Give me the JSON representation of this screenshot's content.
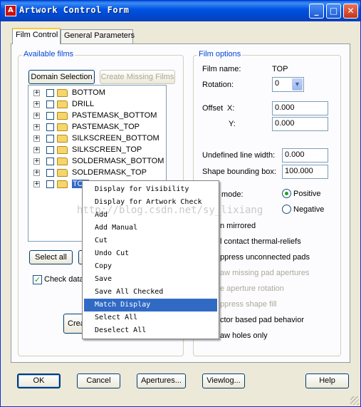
{
  "window": {
    "title": "Artwork Control Form",
    "app_icon": "allegro-app-icon",
    "controls": {
      "minimize": "_",
      "maximize": "□",
      "close": "✕"
    }
  },
  "tabs": [
    {
      "label": "Film Control",
      "active": true
    },
    {
      "label": "General Parameters",
      "active": false
    }
  ],
  "available_films": {
    "legend": "Available films",
    "domain_selection": "Domain Selection",
    "create_missing_films": "Create Missing Films",
    "films": [
      {
        "label": "BOTTOM"
      },
      {
        "label": "DRILL"
      },
      {
        "label": "PASTEMASK_BOTTOM"
      },
      {
        "label": "PASTEMASK_TOP"
      },
      {
        "label": "SILKSCREEN_BOTTOM"
      },
      {
        "label": "SILKSCREEN_TOP"
      },
      {
        "label": "SOLDERMASK_BOTTOM"
      },
      {
        "label": "SOLDERMASK_TOP"
      },
      {
        "label": "TOP",
        "selected": true
      }
    ],
    "select_all": "Select all",
    "check_database": "Check data",
    "check_database_checked": true,
    "create_button_partial": "Crea"
  },
  "film_options": {
    "legend": "Film options",
    "film_name_label": "Film name:",
    "film_name_value": "TOP",
    "rotation_label": "Rotation:",
    "rotation_value": "0",
    "offset_label": "Offset",
    "offset_x_label": "X:",
    "offset_x_value": "0.000",
    "offset_y_label": "Y:",
    "offset_y_value": "0.000",
    "undefined_line_width_label": "Undefined line width:",
    "undefined_line_width_value": "0.000",
    "shape_bounding_box_label": "Shape bounding box:",
    "shape_bounding_box_value": "100.000",
    "plot_mode_label": "mode:",
    "positive_label": "Positive",
    "negative_label": "Negative",
    "plot_mode_value": "Positive",
    "options": [
      {
        "label": "n mirrored",
        "disabled": false
      },
      {
        "label": "l contact thermal-reliefs",
        "disabled": false
      },
      {
        "label": "ppress unconnected pads",
        "disabled": false
      },
      {
        "label": "aw missing pad apertures",
        "disabled": true
      },
      {
        "label": "e aperture rotation",
        "disabled": true
      },
      {
        "label": "ppress shape fill",
        "disabled": true
      },
      {
        "label": "ctor based pad behavior",
        "disabled": false
      },
      {
        "label": "aw holes only",
        "disabled": false
      }
    ]
  },
  "context_menu": {
    "items": [
      {
        "label": "Display for Visibility"
      },
      {
        "label": "Display for Artwork Check"
      },
      {
        "label": "Add"
      },
      {
        "label": "Add Manual"
      },
      {
        "label": "Cut"
      },
      {
        "label": "Undo Cut"
      },
      {
        "label": "Copy"
      },
      {
        "label": "Save"
      },
      {
        "label": "Save All Checked"
      },
      {
        "label": "Match Display",
        "highlighted": true
      },
      {
        "label": "Select All"
      },
      {
        "label": "Deselect All"
      }
    ]
  },
  "footer": {
    "ok": "OK",
    "cancel": "Cancel",
    "apertures": "Apertures...",
    "viewlog": "Viewlog...",
    "help": "Help"
  },
  "watermark": "http://blog.csdn.net/sy_lixiang"
}
